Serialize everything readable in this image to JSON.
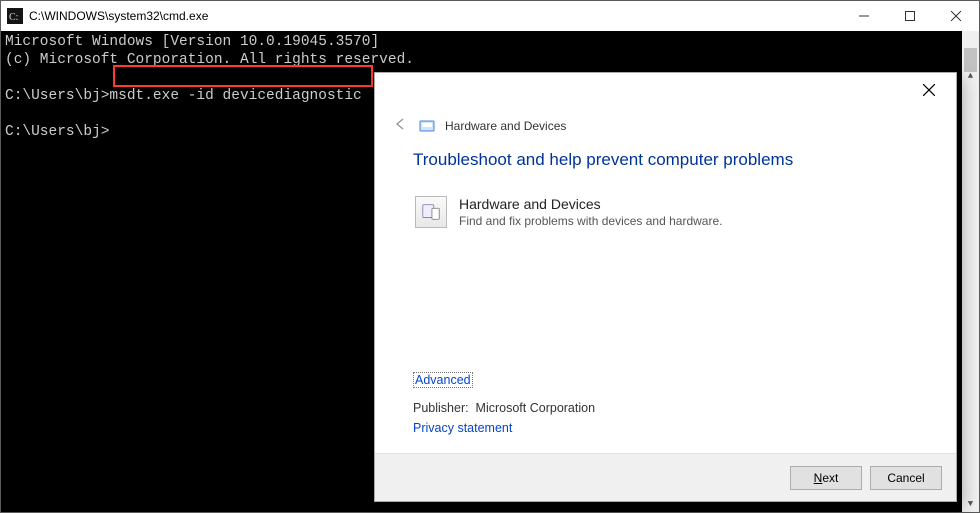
{
  "cmd": {
    "title": "C:\\WINDOWS\\system32\\cmd.exe",
    "line1": "Microsoft Windows [Version 10.0.19045.3570]",
    "line2": "(c) Microsoft Corporation. All rights reserved.",
    "prompt1_prefix": "C:\\Users\\bj>",
    "prompt1_cmd": "msdt.exe -id devicediagnostic",
    "prompt2": "C:\\Users\\bj>"
  },
  "dialog": {
    "breadcrumb": "Hardware and Devices",
    "title": "Troubleshoot and help prevent computer problems",
    "option_title": "Hardware and Devices",
    "option_desc": "Find and fix problems with devices and hardware.",
    "advanced": "Advanced",
    "publisher_label": "Publisher:",
    "publisher_value": "Microsoft Corporation",
    "privacy": "Privacy statement",
    "next_prefix": "N",
    "next_rest": "ext",
    "cancel": "Cancel"
  }
}
